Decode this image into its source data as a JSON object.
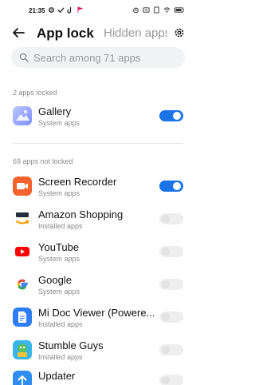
{
  "status_bar": {
    "time": "21:35",
    "left_icons": [
      "settings-icon",
      "check-icon",
      "tiktok-icon",
      "flag-icon"
    ],
    "right_icons": [
      "alarm-icon",
      "battery-saver-icon",
      "sim-icon",
      "wifi-icon",
      "battery-icon"
    ]
  },
  "header": {
    "title": "App lock",
    "tab_hidden": "Hidden apps",
    "back_icon": "back-arrow-icon",
    "settings_icon": "gear-icon"
  },
  "search": {
    "placeholder": "Search among 71 apps",
    "icon": "search-icon"
  },
  "locked_section": {
    "label": "2 apps locked",
    "apps": [
      {
        "name": "Gallery",
        "category": "System apps",
        "icon": "gallery-icon",
        "locked": true
      }
    ]
  },
  "unlocked_section": {
    "label": "69 apps not locked",
    "apps": [
      {
        "name": "Screen Recorder",
        "category": "System apps",
        "icon": "screen-recorder-icon",
        "locked": true
      },
      {
        "name": "Amazon Shopping",
        "category": "Installed apps",
        "icon": "amazon-icon",
        "locked": false
      },
      {
        "name": "YouTube",
        "category": "System apps",
        "icon": "youtube-icon",
        "locked": false
      },
      {
        "name": "Google",
        "category": "System apps",
        "icon": "google-icon",
        "locked": false
      },
      {
        "name": "Mi Doc Viewer (Powere...",
        "category": "Installed apps",
        "icon": "mi-doc-viewer-icon",
        "locked": false
      },
      {
        "name": "Stumble Guys",
        "category": "Installed apps",
        "icon": "stumble-guys-icon",
        "locked": false
      },
      {
        "name": "Updater",
        "category": "",
        "icon": "updater-icon",
        "locked": false
      }
    ]
  },
  "colors": {
    "accent": "#1a73e8",
    "toggle_off": "#eeeeee",
    "search_bg": "#f1f2f4"
  }
}
